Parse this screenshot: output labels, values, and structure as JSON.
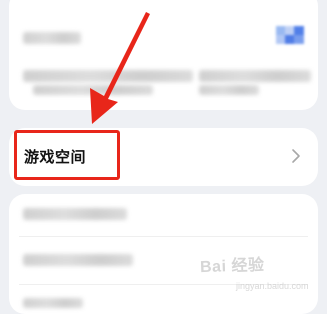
{
  "settings": {
    "game_space_label": "游戏空间"
  },
  "watermark": {
    "text": "Bai 经验",
    "sub": "jingyan.baidu.com"
  },
  "colors": {
    "highlight": "#e8261a",
    "background": "#eef0f4"
  },
  "icons": {
    "chevron": "chevron-right-icon"
  }
}
